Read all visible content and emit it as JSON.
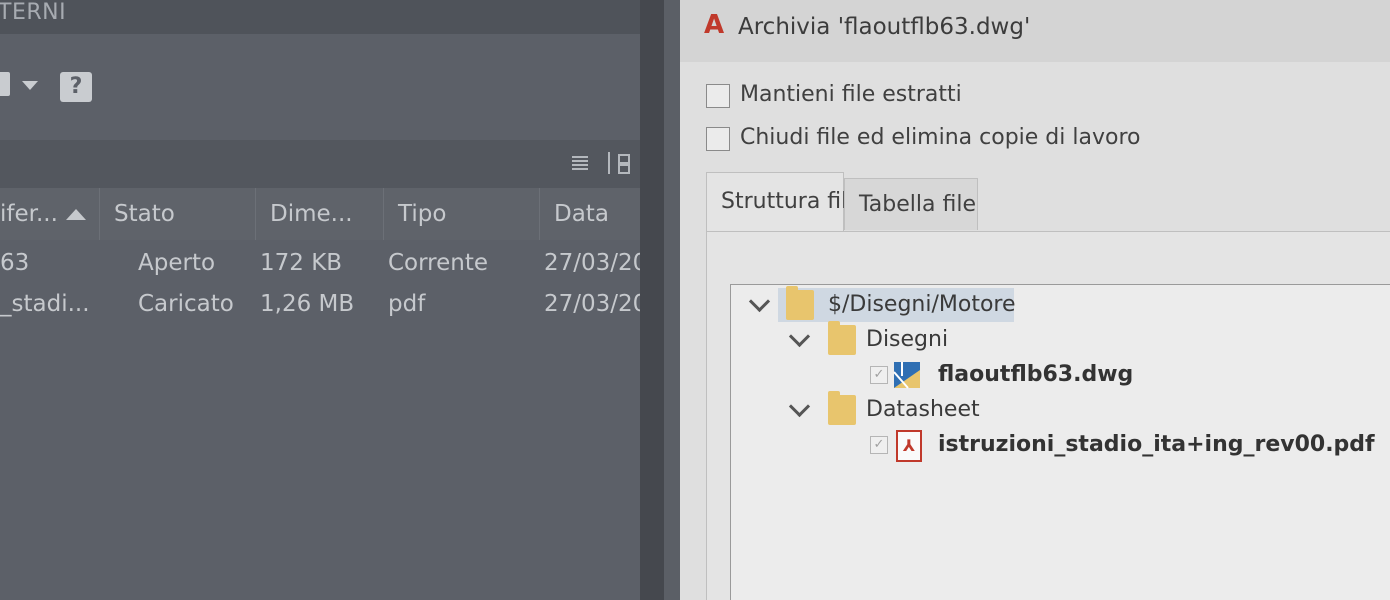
{
  "left_panel": {
    "title_fragment": "TERNI",
    "help_icon": "help-icon",
    "columns": [
      {
        "label": "ifer...",
        "sorted": "asc"
      },
      {
        "label": "Stato"
      },
      {
        "label": "Dime..."
      },
      {
        "label": "Tipo"
      },
      {
        "label": "Data"
      }
    ],
    "rows": [
      {
        "name": "63",
        "stato": "Aperto",
        "dim": "172 KB",
        "tipo": "Corrente",
        "data": "27/03/20"
      },
      {
        "name": "_stadi...",
        "stato": "Caricato",
        "dim": "1,26 MB",
        "tipo": "pdf",
        "data": "27/03/20"
      }
    ]
  },
  "dialog": {
    "title": "Archivia 'flaoutflb63.dwg'",
    "logo_letter": "A",
    "options": [
      {
        "label": "Mantieni file estratti",
        "checked": false
      },
      {
        "label": "Chiudi file ed elimina copie di lavoro",
        "checked": false
      }
    ],
    "tabs": [
      {
        "label": "Struttura file",
        "active": true
      },
      {
        "label": "Tabella file",
        "active": false
      }
    ],
    "tree": {
      "root": "$/Disegni/Motore",
      "folders": [
        {
          "name": "Disegni",
          "files": [
            {
              "name": "flaoutflb63.dwg",
              "icon": "dwg-file-icon"
            }
          ]
        },
        {
          "name": "Datasheet",
          "files": [
            {
              "name": "istruzioni_stadio_ita+ing_rev00.pdf",
              "icon": "pdf-file-icon"
            }
          ]
        }
      ]
    }
  },
  "colors": {
    "left_bg": "#5c6068",
    "dialog_bg": "#dfdfdf",
    "logo_red": "#c0392b",
    "folder_yellow": "#e8c56d",
    "selection_blue": "#cfd8e2"
  }
}
